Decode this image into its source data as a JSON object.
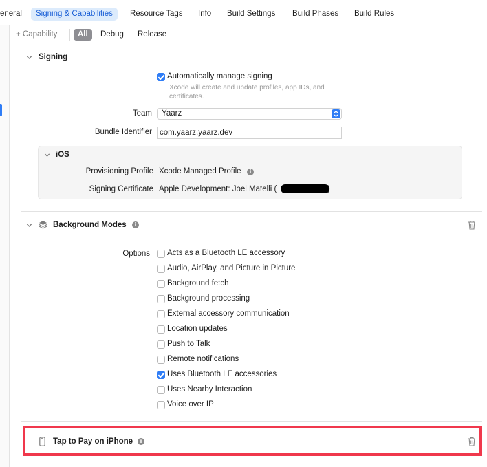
{
  "tabs": {
    "general": "eneral",
    "signing": "Signing & Capabilities",
    "resource_tags": "Resource Tags",
    "info": "Info",
    "build_settings": "Build Settings",
    "build_phases": "Build Phases",
    "build_rules": "Build Rules",
    "active": "Signing & Capabilities"
  },
  "filterbar": {
    "add_capability": "+ Capability",
    "all": "All",
    "debug": "Debug",
    "release": "Release"
  },
  "signing": {
    "title": "Signing",
    "auto_manage_label": "Automatically manage signing",
    "auto_manage_checked": true,
    "auto_manage_help_line1": "Xcode will create and update profiles, app IDs, and",
    "auto_manage_help_line2": "certificates.",
    "team_label": "Team",
    "team_value": "Yaarz",
    "bundle_label": "Bundle Identifier",
    "bundle_value": "com.yaarz.yaarz.dev",
    "ios": {
      "title": "iOS",
      "provisioning_label": "Provisioning Profile",
      "provisioning_value": "Xcode Managed Profile",
      "certificate_label": "Signing Certificate",
      "certificate_value_prefix": "Apple Development: Joel Matelli (",
      "certificate_value_suffix": ")"
    }
  },
  "background_modes": {
    "title": "Background Modes",
    "options_label": "Options",
    "options": [
      {
        "label": "Acts as a Bluetooth LE accessory",
        "checked": false
      },
      {
        "label": "Audio, AirPlay, and Picture in Picture",
        "checked": false
      },
      {
        "label": "Background fetch",
        "checked": false
      },
      {
        "label": "Background processing",
        "checked": false
      },
      {
        "label": "External accessory communication",
        "checked": false
      },
      {
        "label": "Location updates",
        "checked": false
      },
      {
        "label": "Push to Talk",
        "checked": false
      },
      {
        "label": "Remote notifications",
        "checked": false
      },
      {
        "label": "Uses Bluetooth LE accessories",
        "checked": true
      },
      {
        "label": "Uses Nearby Interaction",
        "checked": false
      },
      {
        "label": "Voice over IP",
        "checked": false
      }
    ]
  },
  "tap_to_pay": {
    "title": "Tap to Pay on iPhone"
  },
  "colors": {
    "accent": "#2f7df6",
    "active_tab_bg": "#dcebfc",
    "active_tab_text": "#1a5fd6",
    "highlight_border": "#f0384c"
  },
  "icons": {
    "info": "info-circle-icon",
    "trash": "trash-icon",
    "chevron": "chevron-down-icon",
    "background_modes": "layers-icon",
    "tap_to_pay": "iphone-icon"
  }
}
